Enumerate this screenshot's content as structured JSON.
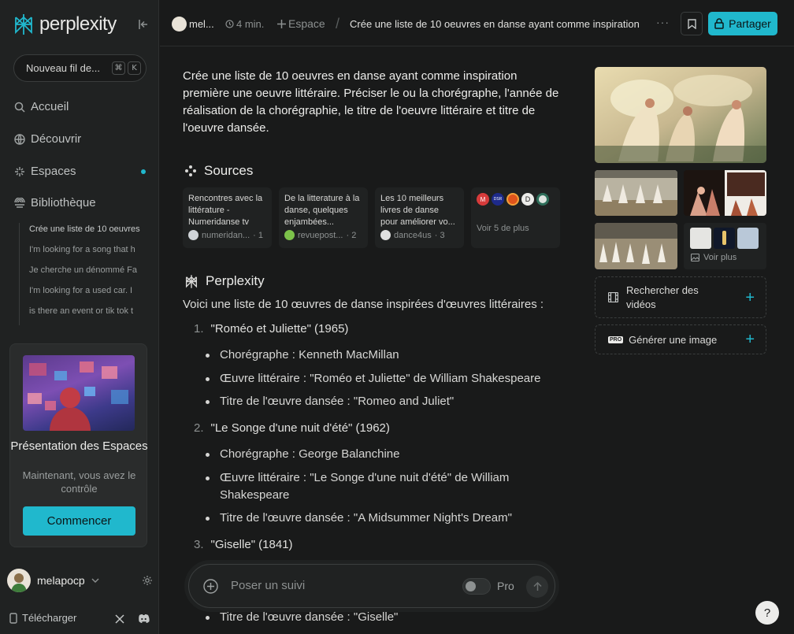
{
  "sidebar": {
    "logo_text": "perplexity",
    "new_thread_label": "Nouveau fil de...",
    "shortcut_keys": [
      "⌘",
      "K"
    ],
    "nav": [
      {
        "label": "Accueil",
        "icon": "search-icon"
      },
      {
        "label": "Découvrir",
        "icon": "globe-icon"
      },
      {
        "label": "Espaces",
        "icon": "spaces-icon"
      },
      {
        "label": "Bibliothèque",
        "icon": "library-icon"
      }
    ],
    "library_items": [
      "Crée une liste de 10 oeuvres",
      "I'm looking for a song that h",
      "Je cherche un dénommé Fa",
      "I'm looking for a used car. I",
      "is there an event or tik tok t"
    ],
    "promo": {
      "title": "Présentation des Espaces",
      "subtitle": "Maintenant, vous avez le contrôle",
      "button": "Commencer"
    },
    "username": "melapocp",
    "download_label": "Télécharger"
  },
  "header": {
    "user": "mel...",
    "time": "4 min.",
    "space_label": "Espace",
    "separator": "/",
    "title": "Crée une liste de 10 oeuvres en danse ayant comme inspiration",
    "more": "···",
    "share_label": "Partager"
  },
  "question": "Crée une liste de 10 oeuvres en danse ayant comme inspiration première une oeuvre littéraire. Préciser le ou la chorégraphe, l'année de réalisation de la chorégraphie, le titre de l'oeuvre littéraire et titre de l'oeuvre dansée.",
  "sources": {
    "title": "Sources",
    "items": [
      {
        "title": "Rencontres avec la littérature - Numeridanse tv",
        "site": "numeridan...",
        "index": "· 1",
        "color": "#d0d4d8"
      },
      {
        "title": "De la litterature à la danse, quelques enjambées...",
        "site": "revuepost...",
        "index": "· 2",
        "color": "#7cc24a"
      },
      {
        "title": "Les 10 meilleurs livres de danse pour améliorer vo...",
        "site": "dance4us",
        "index": "· 3",
        "color": "#e0e0e0"
      }
    ],
    "see_more": "Voir 5 de plus",
    "more_icon_labels": [
      "M",
      "DSR",
      "",
      "D",
      ""
    ]
  },
  "answer": {
    "title": "Perplexity",
    "intro": "Voici une liste de 10 œuvres de danse inspirées d'œuvres littéraires :",
    "works": [
      {
        "num": "1.",
        "heading": "\"Roméo et Juliette\" (1965)",
        "bullets": [
          "Chorégraphe : Kenneth MacMillan",
          "Œuvre littéraire : \"Roméo et Juliette\" de William Shakespeare",
          "Titre de l'œuvre dansée : \"Romeo and Juliet\""
        ]
      },
      {
        "num": "2.",
        "heading": "\"Le Songe d'une nuit d'été\" (1962)",
        "bullets": [
          "Chorégraphe : George Balanchine",
          "Œuvre littéraire : \"Le Songe d'une nuit d'été\" de William Shakespeare",
          "Titre de l'œuvre dansée : \"A Midsummer Night's Dream\""
        ]
      },
      {
        "num": "3.",
        "heading": "\"Giselle\" (1841)",
        "bullets": [
          "Titre de l'œuvre dansée : \"Giselle\""
        ]
      }
    ]
  },
  "images": {
    "see_more": "Voir plus"
  },
  "side_actions": {
    "search_videos": "Rechercher des vidéos",
    "generate_image": "Générer une image",
    "pro_badge": "PRO"
  },
  "composer": {
    "placeholder": "Poser un suivi",
    "pro_label": "Pro"
  },
  "help_label": "?",
  "colors": {
    "accent": "#20b8cd",
    "background": "#191a1a",
    "sidebar": "#202222"
  }
}
